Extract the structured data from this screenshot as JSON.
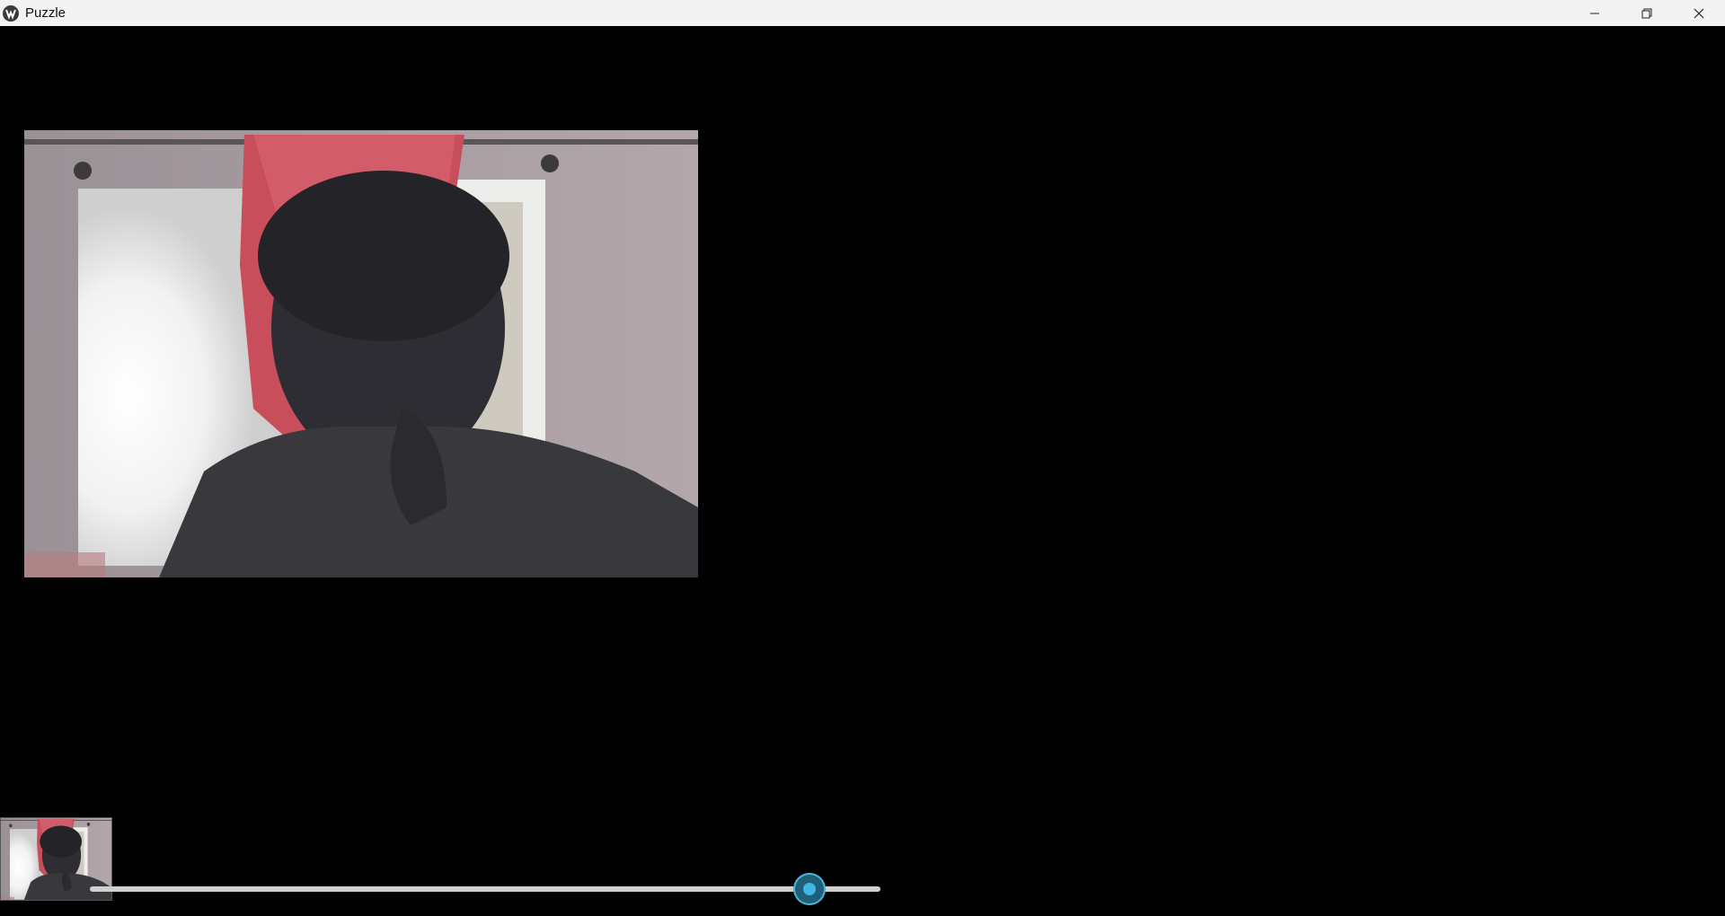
{
  "window": {
    "title": "Puzzle",
    "controls": {
      "minimize_icon": "minimize-icon",
      "restore_icon": "restore-icon",
      "close_icon": "close-icon"
    }
  },
  "puzzle": {
    "image_description_icon": "webcam-frame",
    "grid": {
      "rows": 2,
      "cols": 3
    }
  },
  "slider": {
    "value_fraction": 0.91
  },
  "colors": {
    "titlebar": "#f3f3f3",
    "background": "#000000",
    "slider_track": "#cfcfcf",
    "slider_thumb": "#3fb6e6"
  }
}
